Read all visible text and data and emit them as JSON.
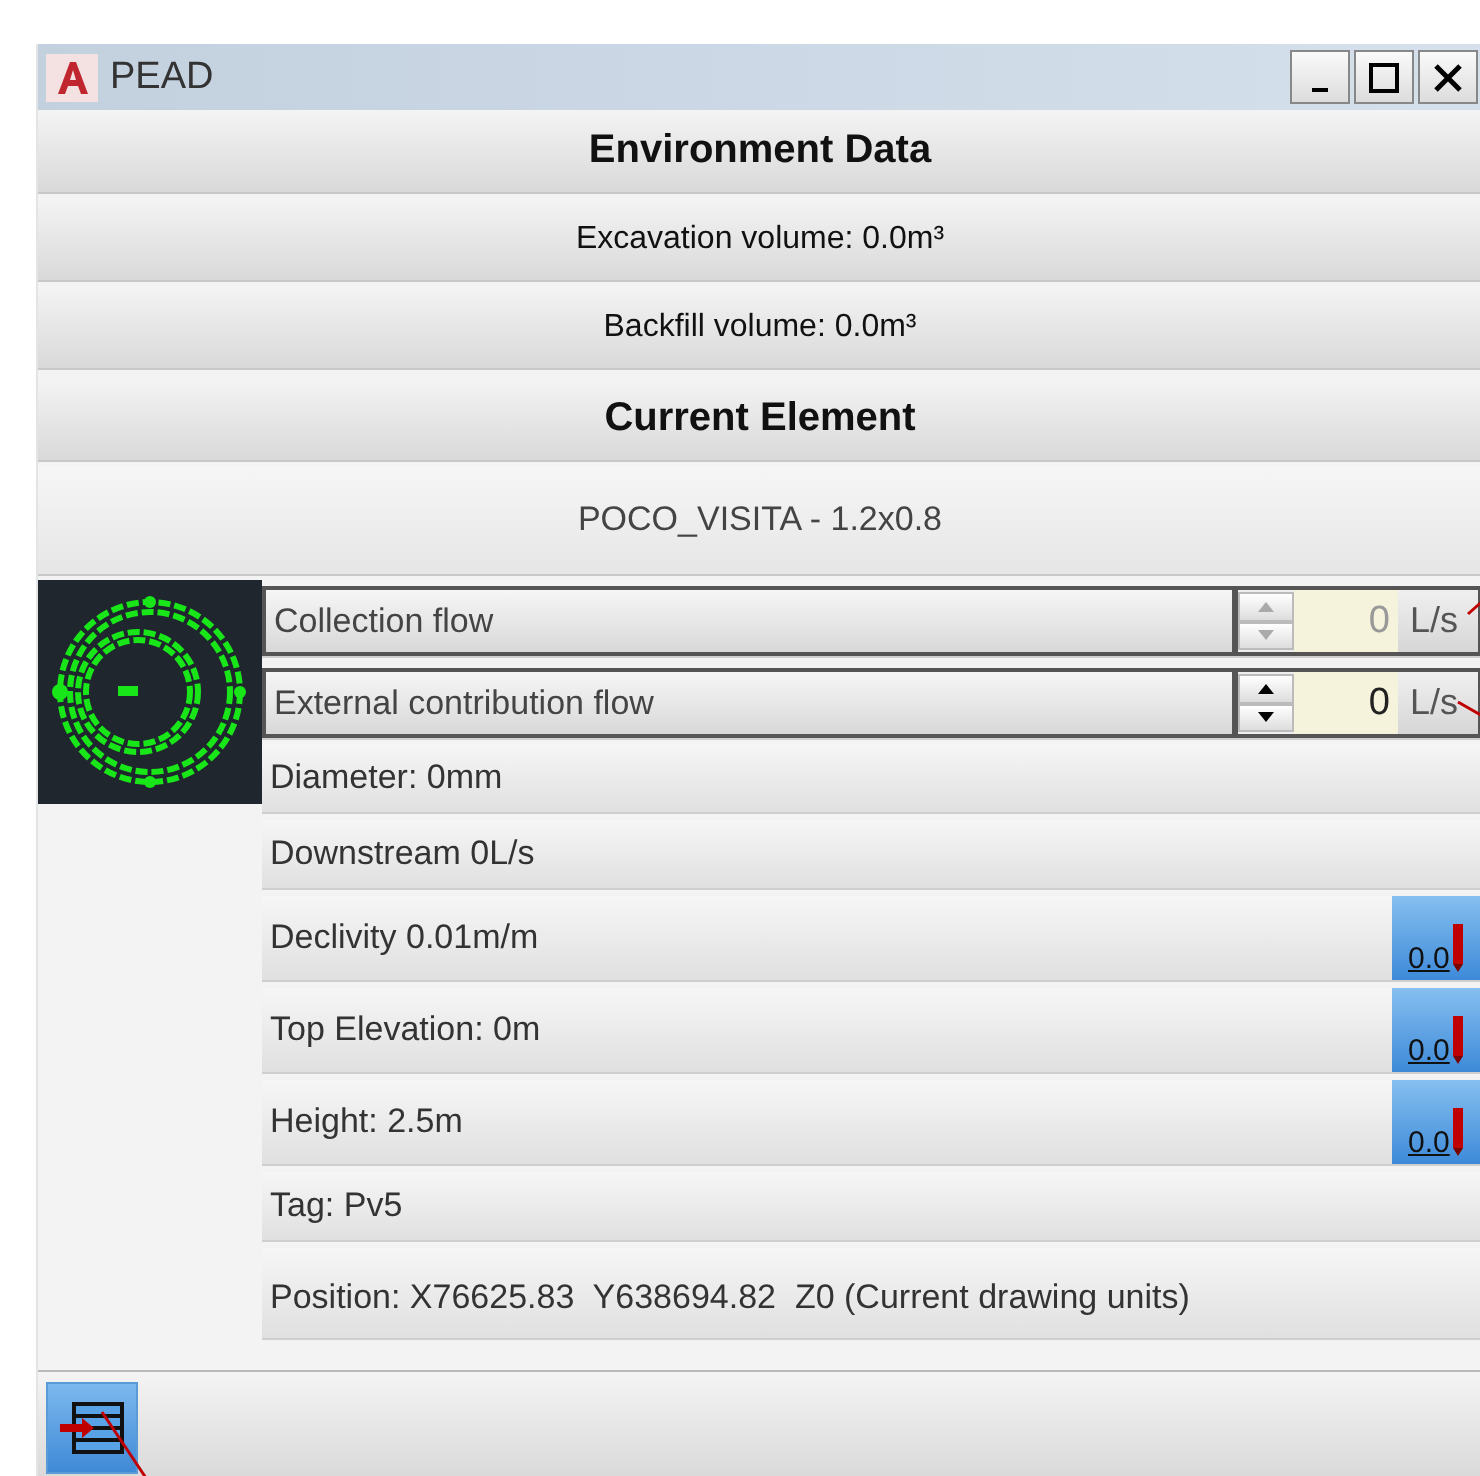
{
  "window": {
    "title": "PEAD"
  },
  "environment": {
    "heading": "Environment Data",
    "lines": [
      "Excavation volume: 0.0m³",
      "Backfill volume: 0.0m³"
    ]
  },
  "current_element": {
    "heading": "Current Element",
    "name": "POCO_VISITA - 1.2x0.8"
  },
  "properties": [
    {
      "kind": "spinner",
      "label": "Collection flow",
      "value": "0",
      "unit": "L/s",
      "disabled": true
    },
    {
      "kind": "spinner",
      "label": "External contribution flow",
      "value": "0",
      "unit": "L/s",
      "disabled": false
    },
    {
      "kind": "text",
      "label": "Diameter: 0mm"
    },
    {
      "kind": "text",
      "label": "Downstream 0L/s"
    },
    {
      "kind": "pick",
      "label": "Declivity 0.01m/m",
      "button": "0.0"
    },
    {
      "kind": "pick",
      "label": "Top Elevation: 0m",
      "button": "0.0"
    },
    {
      "kind": "pick",
      "label": "Height: 2.5m",
      "button": "0.0"
    },
    {
      "kind": "text",
      "label": "Tag: Pv5"
    },
    {
      "kind": "tall",
      "label": "Position: X76625.83  Y638694.82  Z0 (Current drawing units)"
    }
  ]
}
